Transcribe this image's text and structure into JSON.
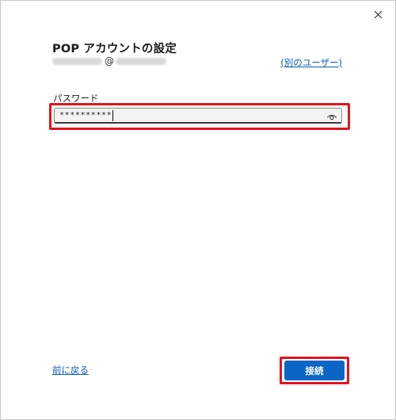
{
  "dialog": {
    "title": "POP アカウントの設定",
    "account_at": "@",
    "other_user_link": "(別のユーザー)",
    "password_label": "パスワード",
    "password_value": "**********",
    "back_link": "前に戻る",
    "connect_label": "接続"
  },
  "icons": {
    "close": "close-icon",
    "reveal": "eye-icon"
  },
  "colors": {
    "accent": "#0a67c6",
    "link": "#0a5bb5",
    "highlight": "#e3141b"
  }
}
